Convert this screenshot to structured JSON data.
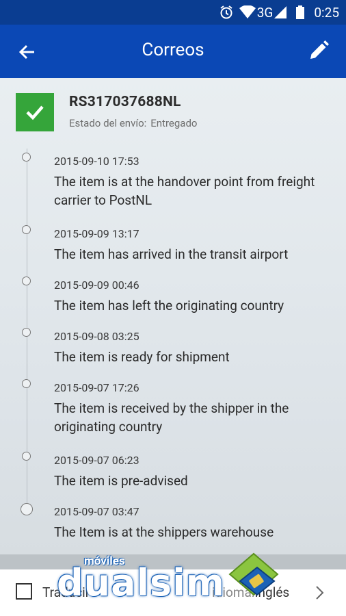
{
  "status_bar": {
    "network": "3G",
    "time": "0:25",
    "icons": [
      "alarm-icon",
      "wifi-icon",
      "signal-icon",
      "battery-icon"
    ]
  },
  "toolbar": {
    "title": "Correos",
    "back_icon": "arrow-left-icon",
    "edit_icon": "pencil-icon",
    "color": "#0b48b5"
  },
  "shipment": {
    "tracking_id": "RS317037688NL",
    "status_label": "Estado del envío:",
    "status_value": "Entregado",
    "status_color": "#35a53a"
  },
  "events": [
    {
      "date": "2015-09-10 17:53",
      "description": "The item is at the handover point from freight carrier to PostNL"
    },
    {
      "date": "2015-09-09 13:17",
      "description": "The item has arrived in the transit airport"
    },
    {
      "date": "2015-09-09 00:46",
      "description": "The item has left the originating country"
    },
    {
      "date": "2015-09-08 03:25",
      "description": "The item is ready for shipment"
    },
    {
      "date": "2015-09-07 17:26",
      "description": "The item is received by the shipper in the originating country"
    },
    {
      "date": "2015-09-07 06:23",
      "description": "The item is pre-advised"
    },
    {
      "date": "2015-09-07 03:47",
      "description": "The Item is at the shippers warehouse"
    }
  ],
  "footer": {
    "translate_label": "Traducir",
    "language_label": "idioma:",
    "language_value": "Inglés"
  },
  "watermark": {
    "top": "móviles",
    "main": "dualsim"
  }
}
